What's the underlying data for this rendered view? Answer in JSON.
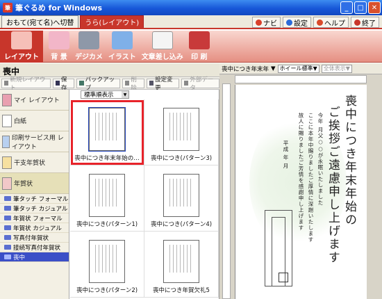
{
  "window": {
    "title": "筆ぐるめ for Windows",
    "logo_text": "筆"
  },
  "tabs": [
    {
      "label": "おもて(宛て名)へ切替"
    },
    {
      "label": "うら(レイアウト)"
    }
  ],
  "header_links": [
    {
      "label": "ナビ",
      "color": "#d9402b"
    },
    {
      "label": "設定",
      "color": "#2b6bd9"
    },
    {
      "label": "ヘルプ",
      "color": "#d94a2b"
    },
    {
      "label": "終了",
      "color": "#c8362b"
    }
  ],
  "toolbar": [
    {
      "label": "レイアウト",
      "active": true
    },
    {
      "label": "背 景"
    },
    {
      "label": "デジカメ"
    },
    {
      "label": "イラスト"
    },
    {
      "label": "文章差し込み"
    },
    {
      "label": "印 刷"
    }
  ],
  "section_title": "喪中",
  "subtoolbar": [
    {
      "label": "新規レイアウト",
      "disabled": true
    },
    {
      "label": "保存"
    },
    {
      "label": "バックアップ"
    },
    {
      "label": "削除",
      "disabled": true
    },
    {
      "label": "設定変更"
    },
    {
      "label": "外部データ",
      "disabled": true
    }
  ],
  "left_list": {
    "categories": [
      {
        "label": "マイ レイアウト"
      },
      {
        "label": "白紙"
      },
      {
        "label": "印刷サービス用 レイアウト"
      },
      {
        "label": "干支年賀状"
      },
      {
        "label": "年賀状",
        "active": true
      }
    ],
    "folders": [
      {
        "label": "筆タッチ フォーマル"
      },
      {
        "label": "筆タッチ カジュアル"
      },
      {
        "label": "年賀状 フォーマル"
      },
      {
        "label": "年賀状 カジュアル"
      },
      {
        "label": "写真付年賀状"
      },
      {
        "label": "接続写真付年賀状"
      },
      {
        "label": "喪中",
        "selected": true
      }
    ]
  },
  "sort": {
    "value": "標準順表示"
  },
  "templates": [
    {
      "caption": "喪中につき年末年始の…",
      "selected": true
    },
    {
      "caption": "喪中につき(パターン3)"
    },
    {
      "caption": "喪中につき(パターン1)"
    },
    {
      "caption": "喪中につき(パターン4)"
    },
    {
      "caption": "喪中につき(パターン2)"
    },
    {
      "caption": "喪中につき年賀欠礼5"
    }
  ],
  "preview": {
    "title": "喪中につき年末年",
    "zoom": "ホイール標準",
    "view": "全体表示",
    "line1": "喪中につき年末年始の",
    "line2": "ご挨拶ご遠慮申し上げます",
    "body1": "今年 月父○○が永眠いたしました",
    "body2": "ここに本年中賜りましたご厚情に深謝いたします",
    "body3": "故人に賜りましたご芳情を感謝申し上げます",
    "date": "平成 年 月"
  }
}
